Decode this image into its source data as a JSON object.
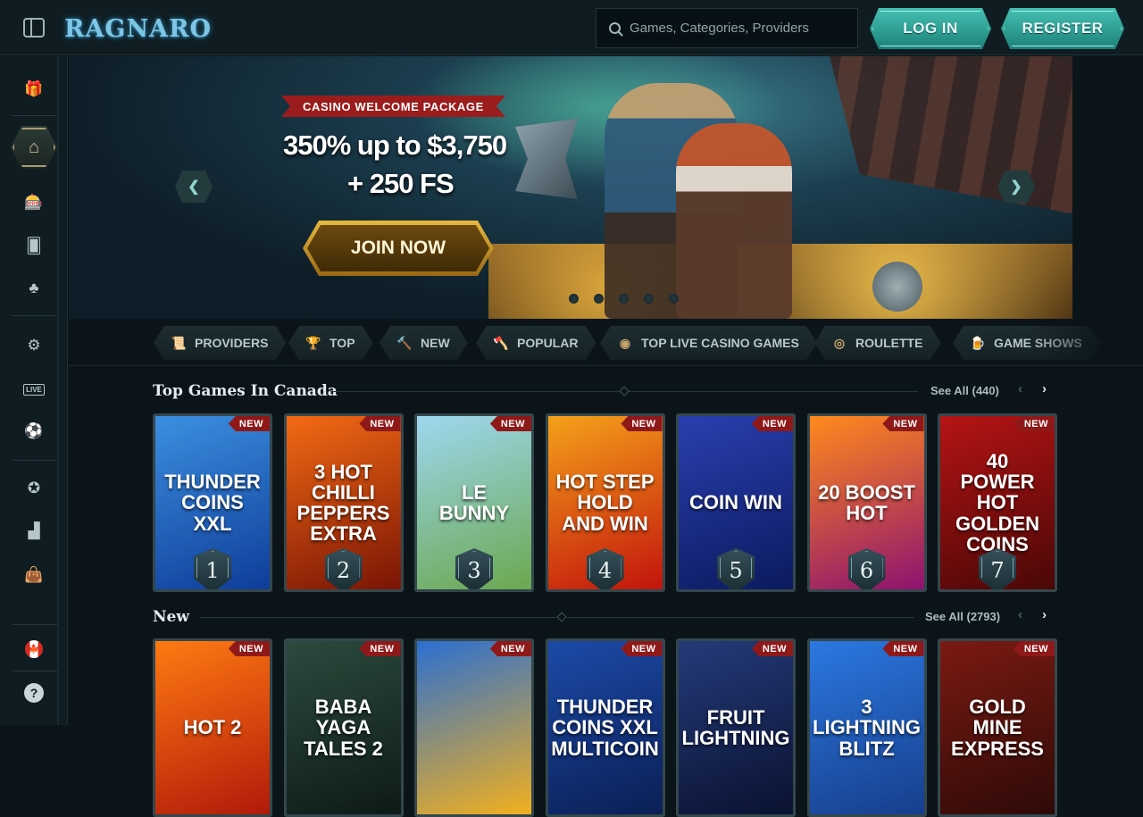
{
  "header": {
    "logo_text": "RAGNARO",
    "search_placeholder": "Games, Categories, Providers",
    "login_label": "LOG IN",
    "register_label": "REGISTER"
  },
  "sidebar": {
    "items": [
      {
        "name": "gift-icon",
        "glyph": "🎁"
      },
      {
        "name": "home-icon",
        "glyph": "⌂"
      },
      {
        "name": "slot-machine-icon",
        "glyph": "🎰"
      },
      {
        "name": "cards-icon",
        "glyph": "🂠"
      },
      {
        "name": "clover-icon",
        "glyph": "♣"
      },
      {
        "name": "gear-icon",
        "glyph": "⚙"
      },
      {
        "name": "live-icon",
        "glyph": "LIVE"
      },
      {
        "name": "sports-icon",
        "glyph": "⚽"
      },
      {
        "name": "medal-icon",
        "glyph": "✪"
      },
      {
        "name": "podium-icon",
        "glyph": "▟"
      },
      {
        "name": "shop-icon",
        "glyph": "👜"
      },
      {
        "name": "flag-canada-icon",
        "glyph": "🍁"
      },
      {
        "name": "help-icon",
        "glyph": "?"
      }
    ]
  },
  "banner": {
    "tag": "CASINO WELCOME PACKAGE",
    "line1": "350% up to $3,750",
    "line2": "+ 250 FS",
    "cta": "JOIN NOW",
    "prev": "❮",
    "next": "❯"
  },
  "categories": [
    {
      "label": "PROVIDERS",
      "icon": "📜"
    },
    {
      "label": "TOP",
      "icon": "🏆"
    },
    {
      "label": "NEW",
      "icon": "🔨"
    },
    {
      "label": "POPULAR",
      "icon": "🪓"
    },
    {
      "label": "TOP LIVE CASINO GAMES",
      "icon": "◉"
    },
    {
      "label": "ROULETTE",
      "icon": "◎"
    },
    {
      "label": "GAME SHOWS",
      "icon": "🍺"
    }
  ],
  "top_games": {
    "title": "Top Games In Canada",
    "see_all": "See All (440)",
    "prev": "‹",
    "next": "›",
    "badge": "NEW",
    "cards": [
      {
        "title": "THUNDER COINS XXL",
        "rank": "1",
        "colors": [
          "#3c8fe0",
          "#0e3d9a"
        ]
      },
      {
        "title": "3 HOT CHILLI PEPPERS EXTRA",
        "rank": "2",
        "colors": [
          "#f36a14",
          "#7a1405"
        ]
      },
      {
        "title": "LE BUNNY",
        "rank": "3",
        "colors": [
          "#9fd7f0",
          "#6aa84f"
        ]
      },
      {
        "title": "HOT STEP HOLD AND WIN",
        "rank": "4",
        "colors": [
          "#f5a11a",
          "#c2140c"
        ]
      },
      {
        "title": "COIN WIN",
        "rank": "5",
        "colors": [
          "#2a3fb0",
          "#0b1a5e"
        ]
      },
      {
        "title": "20 BOOST HOT",
        "rank": "6",
        "colors": [
          "#ff8a1c",
          "#8e1270"
        ]
      },
      {
        "title": "40 POWER HOT GOLDEN COINS",
        "rank": "7",
        "colors": [
          "#b51414",
          "#4a0707"
        ]
      }
    ]
  },
  "new_games": {
    "title": "New",
    "see_all": "See All (2793)",
    "prev": "‹",
    "next": "›",
    "badge": "NEW",
    "cards": [
      {
        "title": "HOT 2",
        "colors": [
          "#ff7a12",
          "#b11a0a"
        ]
      },
      {
        "title": "BABA YAGA TALES 2",
        "colors": [
          "#2c4a3e",
          "#0d1a16"
        ]
      },
      {
        "title": "",
        "colors": [
          "#2b6fd1",
          "#f2b01e"
        ]
      },
      {
        "title": "THUNDER COINS XXL MULTICOIN",
        "colors": [
          "#1c4aa8",
          "#0b1f55"
        ]
      },
      {
        "title": "FRUIT LIGHTNING",
        "colors": [
          "#243a7a",
          "#0a1230"
        ]
      },
      {
        "title": "3 LIGHTNING BLITZ",
        "colors": [
          "#2b78e0",
          "#173e8c"
        ]
      },
      {
        "title": "GOLD MINE EXPRESS",
        "colors": [
          "#7a1a12",
          "#2e0a08"
        ]
      }
    ]
  }
}
